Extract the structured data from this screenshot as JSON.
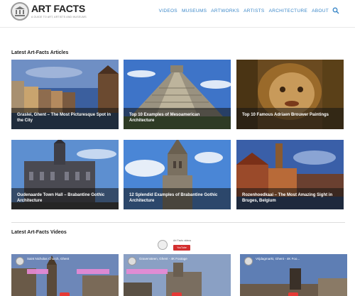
{
  "header": {
    "brand_title": "ART FACTS",
    "brand_tagline": "A GUIDE TO ART, ARTISTS AND MUSEUMS",
    "nav": [
      "VIDEOS",
      "MUSEUMS",
      "ARTWORKS",
      "ARTISTS",
      "ARCHITECTURE",
      "ABOUT"
    ],
    "search_icon": "search-icon",
    "accent_color": "#3a87c8"
  },
  "articles": {
    "title": "Latest Art-Facts Articles",
    "items": [
      {
        "title": "Graslei, Ghent – The Most Picturesque Spot in the City"
      },
      {
        "title": "Top 10 Examples of Mesoamerican Architecture"
      },
      {
        "title": "Top 10 Famous Adriaen Brouwer Paintings"
      },
      {
        "title": "Oudenaarde Town Hall – Brabantine Gothic Architecture"
      },
      {
        "title": "12 Splendid Examples of Brabantine Gothic Architecture"
      },
      {
        "title": "Rozenhoedkaai – The Most Amazing Sight in Bruges, Belgium"
      }
    ]
  },
  "videos": {
    "title": "Latest Art-Facts Videos",
    "channel_name": "Art Facts videos",
    "subscribe_label": "YouTube",
    "items": [
      {
        "title": "Saint Nicholas Church, Ghent"
      },
      {
        "title": "Gravensteen, Ghent - 4K Footage"
      },
      {
        "title": "Vrijdagmarkt, Ghent - 4K Foo..."
      }
    ]
  }
}
